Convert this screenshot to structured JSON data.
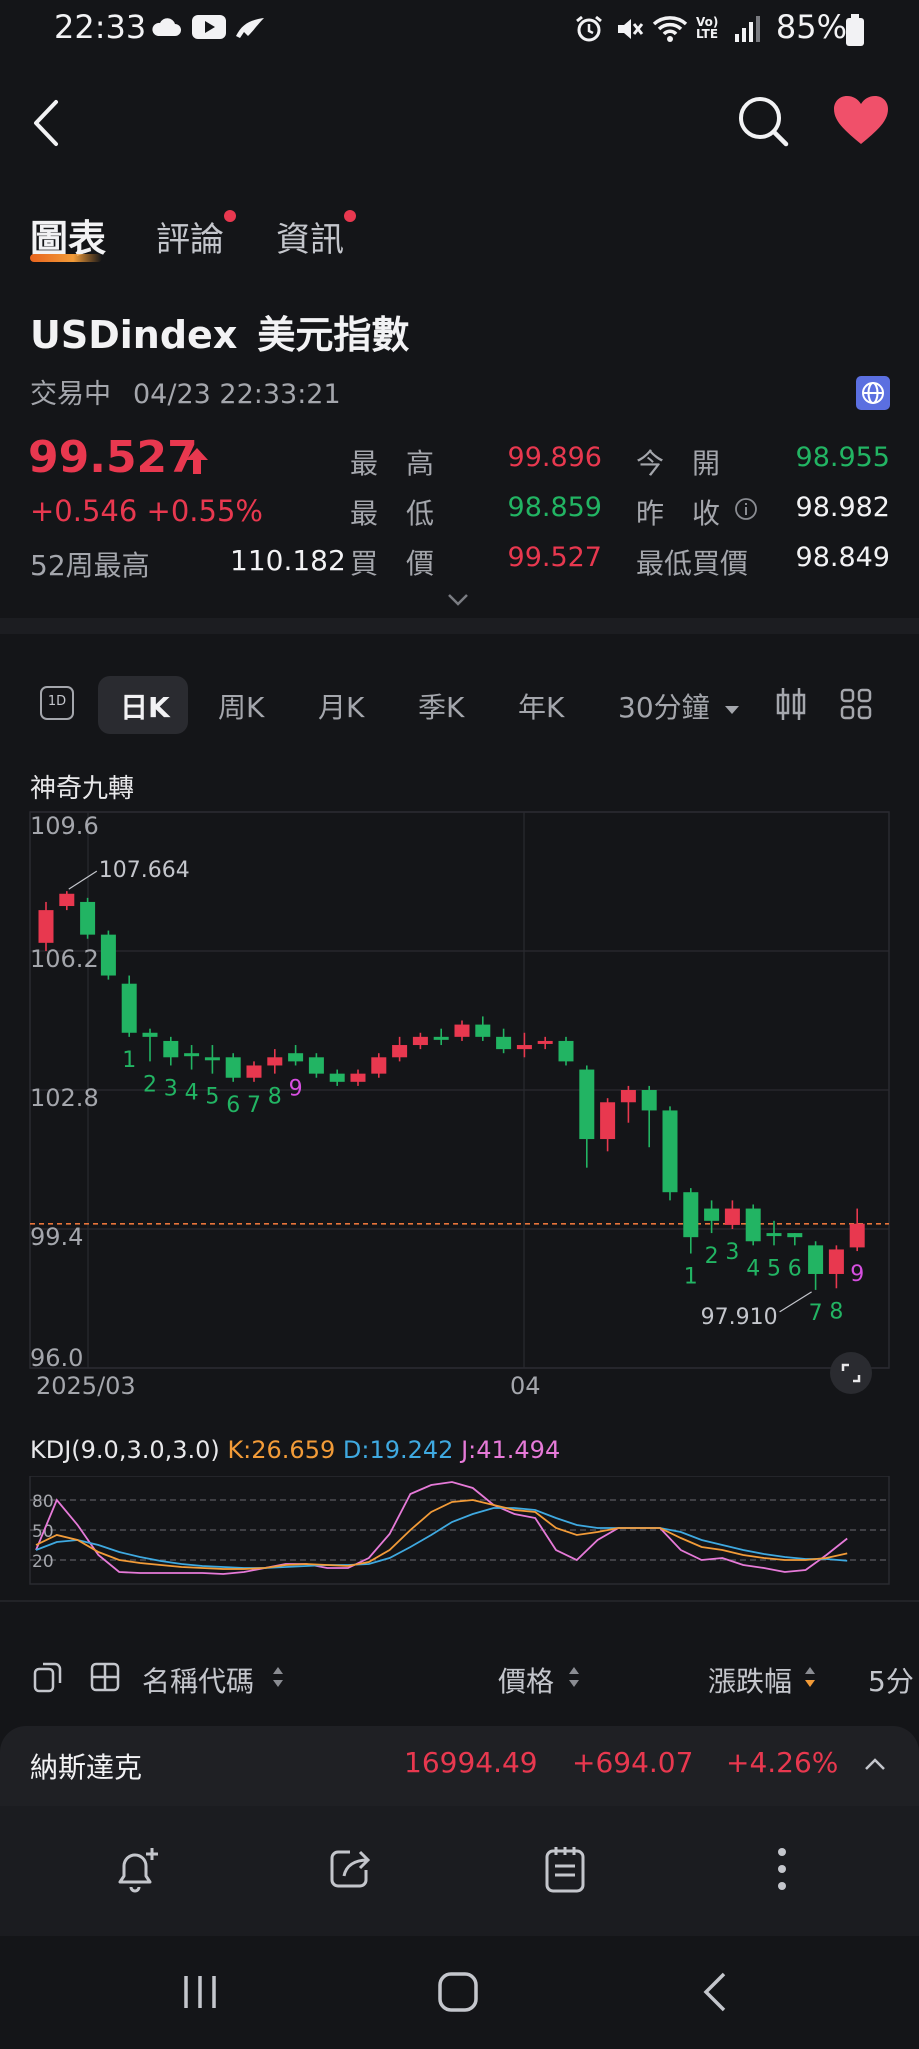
{
  "status_bar": {
    "time": "22:33",
    "battery": "85%"
  },
  "tabs": [
    {
      "label": "圖表"
    },
    {
      "label": "評論"
    },
    {
      "label": "資訊"
    }
  ],
  "instrument": {
    "symbol": "USDindex",
    "name": "美元指數",
    "status": "交易中",
    "datetime": "04/23 22:33:21",
    "price": "99.527",
    "change": "+0.546",
    "change_pct": "+0.55%",
    "w52_high_label": "52周最高",
    "w52_high": "110.182"
  },
  "quote_fields": {
    "high_label": "最　高",
    "high": "99.896",
    "low_label": "最　低",
    "low": "98.859",
    "bid_label": "買　價",
    "bid": "99.527",
    "open_label": "今　開",
    "open": "98.955",
    "prev_close_label": "昨　收",
    "prev_close": "98.982",
    "min_bid_label": "最低買價",
    "min_bid": "98.849"
  },
  "periods": {
    "icon_1d": "1D",
    "items": [
      "日K",
      "周K",
      "月K",
      "季K",
      "年K",
      "30分鐘"
    ],
    "selected": "日K"
  },
  "chart": {
    "indicator_title": "神奇九轉",
    "x_labels": [
      "2025/03",
      "04"
    ],
    "high_annotation": "107.664",
    "low_annotation": "97.910",
    "kdj_label": "KDJ(9.0,3.0,3.0)",
    "k_label": "K:26.659",
    "d_label": "D:19.242",
    "j_label": "J:41.494",
    "kdj_levels": [
      "80",
      "50",
      "20"
    ]
  },
  "chart_data": {
    "type": "candlestick",
    "y_ticks": [
      "109.6",
      "106.2",
      "102.8",
      "99.4",
      "96.0"
    ],
    "ylim": [
      96.0,
      109.6
    ],
    "current_price_line": 99.527,
    "candles": [
      {
        "o": 106.4,
        "c": 107.2,
        "h": 107.4,
        "l": 106.2,
        "up": true
      },
      {
        "o": 107.3,
        "c": 107.6,
        "h": 107.664,
        "l": 107.2,
        "up": true
      },
      {
        "o": 107.4,
        "c": 106.6,
        "h": 107.5,
        "l": 106.5,
        "up": false
      },
      {
        "o": 106.6,
        "c": 105.6,
        "h": 106.7,
        "l": 105.5,
        "up": false
      },
      {
        "o": 105.4,
        "c": 104.2,
        "h": 105.6,
        "l": 104.1,
        "up": false
      },
      {
        "o": 104.2,
        "c": 104.1,
        "h": 104.3,
        "l": 103.5,
        "up": false
      },
      {
        "o": 104.0,
        "c": 103.6,
        "h": 104.1,
        "l": 103.4,
        "up": false
      },
      {
        "o": 103.7,
        "c": 103.7,
        "h": 103.9,
        "l": 103.3,
        "up": false
      },
      {
        "o": 103.6,
        "c": 103.6,
        "h": 103.9,
        "l": 103.2,
        "up": false
      },
      {
        "o": 103.6,
        "c": 103.1,
        "h": 103.7,
        "l": 103.0,
        "up": false
      },
      {
        "o": 103.1,
        "c": 103.4,
        "h": 103.5,
        "l": 103.0,
        "up": true
      },
      {
        "o": 103.4,
        "c": 103.6,
        "h": 103.8,
        "l": 103.2,
        "up": true
      },
      {
        "o": 103.7,
        "c": 103.5,
        "h": 103.9,
        "l": 103.4,
        "up": false
      },
      {
        "o": 103.6,
        "c": 103.2,
        "h": 103.7,
        "l": 103.1,
        "up": false
      },
      {
        "o": 103.2,
        "c": 103.0,
        "h": 103.3,
        "l": 102.9,
        "up": false
      },
      {
        "o": 103.0,
        "c": 103.2,
        "h": 103.3,
        "l": 102.9,
        "up": true
      },
      {
        "o": 103.2,
        "c": 103.6,
        "h": 103.7,
        "l": 103.1,
        "up": true
      },
      {
        "o": 103.6,
        "c": 103.9,
        "h": 104.1,
        "l": 103.5,
        "up": true
      },
      {
        "o": 103.9,
        "c": 104.1,
        "h": 104.2,
        "l": 103.8,
        "up": true
      },
      {
        "o": 104.1,
        "c": 104.1,
        "h": 104.3,
        "l": 103.9,
        "up": false
      },
      {
        "o": 104.1,
        "c": 104.4,
        "h": 104.5,
        "l": 104.0,
        "up": true
      },
      {
        "o": 104.4,
        "c": 104.1,
        "h": 104.6,
        "l": 104.0,
        "up": false
      },
      {
        "o": 104.1,
        "c": 103.8,
        "h": 104.3,
        "l": 103.7,
        "up": false
      },
      {
        "o": 103.8,
        "c": 103.9,
        "h": 104.2,
        "l": 103.6,
        "up": true
      },
      {
        "o": 104.0,
        "c": 104.0,
        "h": 104.1,
        "l": 103.8,
        "up": true
      },
      {
        "o": 104.0,
        "c": 103.5,
        "h": 104.1,
        "l": 103.4,
        "up": false
      },
      {
        "o": 103.3,
        "c": 101.6,
        "h": 103.4,
        "l": 100.9,
        "up": false
      },
      {
        "o": 101.6,
        "c": 102.5,
        "h": 102.6,
        "l": 101.3,
        "up": true
      },
      {
        "o": 102.5,
        "c": 102.8,
        "h": 102.9,
        "l": 102.0,
        "up": true
      },
      {
        "o": 102.8,
        "c": 102.3,
        "h": 102.9,
        "l": 101.4,
        "up": false
      },
      {
        "o": 102.3,
        "c": 100.3,
        "h": 102.4,
        "l": 100.1,
        "up": false
      },
      {
        "o": 100.3,
        "c": 99.2,
        "h": 100.4,
        "l": 98.8,
        "up": false
      },
      {
        "o": 99.9,
        "c": 99.6,
        "h": 100.1,
        "l": 99.3,
        "up": false
      },
      {
        "o": 99.5,
        "c": 99.9,
        "h": 100.1,
        "l": 99.4,
        "up": true
      },
      {
        "o": 99.9,
        "c": 99.1,
        "h": 100.0,
        "l": 99.0,
        "up": false
      },
      {
        "o": 99.3,
        "c": 99.3,
        "h": 99.6,
        "l": 99.0,
        "up": false
      },
      {
        "o": 99.3,
        "c": 99.2,
        "h": 99.3,
        "l": 99.0,
        "up": false
      },
      {
        "o": 99.0,
        "c": 98.3,
        "h": 99.1,
        "l": 97.91,
        "up": false
      },
      {
        "o": 98.3,
        "c": 98.9,
        "h": 99.0,
        "l": 97.95,
        "up": true
      },
      {
        "o": 98.95,
        "c": 99.53,
        "h": 99.9,
        "l": 98.86,
        "up": true
      }
    ],
    "td_counts": [
      {
        "i": 4,
        "n": "1",
        "pos": "below",
        "color": "green"
      },
      {
        "i": 5,
        "n": "2",
        "pos": "below",
        "color": "green"
      },
      {
        "i": 6,
        "n": "3",
        "pos": "below",
        "color": "green"
      },
      {
        "i": 7,
        "n": "4",
        "pos": "below",
        "color": "green"
      },
      {
        "i": 8,
        "n": "5",
        "pos": "below",
        "color": "green"
      },
      {
        "i": 9,
        "n": "6",
        "pos": "below",
        "color": "green"
      },
      {
        "i": 10,
        "n": "7",
        "pos": "below",
        "color": "green"
      },
      {
        "i": 11,
        "n": "8",
        "pos": "below",
        "color": "green"
      },
      {
        "i": 12,
        "n": "9",
        "pos": "below",
        "color": "magenta"
      },
      {
        "i": 31,
        "n": "1",
        "pos": "below",
        "color": "green"
      },
      {
        "i": 32,
        "n": "2",
        "pos": "below",
        "color": "green"
      },
      {
        "i": 33,
        "n": "3",
        "pos": "below",
        "color": "green"
      },
      {
        "i": 34,
        "n": "4",
        "pos": "below",
        "color": "green"
      },
      {
        "i": 35,
        "n": "5",
        "pos": "below",
        "color": "green"
      },
      {
        "i": 36,
        "n": "6",
        "pos": "below",
        "color": "green"
      },
      {
        "i": 37,
        "n": "7",
        "pos": "below",
        "color": "green"
      },
      {
        "i": 38,
        "n": "8",
        "pos": "below",
        "color": "green"
      },
      {
        "i": 39,
        "n": "9",
        "pos": "below",
        "color": "magenta"
      }
    ],
    "kdj": {
      "ylim": [
        0,
        100
      ],
      "K": [
        35,
        45,
        40,
        28,
        20,
        17,
        15,
        13,
        12,
        11,
        11,
        12,
        15,
        16,
        15,
        14,
        18,
        30,
        50,
        68,
        78,
        80,
        75,
        70,
        68,
        52,
        45,
        48,
        52,
        52,
        52,
        42,
        33,
        30,
        25,
        22,
        20,
        20,
        22,
        26.659
      ],
      "D": [
        30,
        38,
        40,
        35,
        28,
        23,
        19,
        16,
        14,
        13,
        12,
        12,
        13,
        14,
        15,
        15,
        16,
        22,
        33,
        45,
        58,
        66,
        72,
        72,
        70,
        62,
        55,
        52,
        52,
        52,
        52,
        48,
        40,
        35,
        30,
        26,
        23,
        21,
        21,
        19.242
      ],
      "J": [
        30,
        80,
        55,
        25,
        8,
        7,
        7,
        7,
        7,
        6,
        8,
        12,
        16,
        16,
        12,
        12,
        22,
        46,
        86,
        95,
        98,
        92,
        75,
        66,
        62,
        30,
        20,
        40,
        52,
        52,
        52,
        30,
        20,
        22,
        15,
        12,
        8,
        10,
        25,
        41.494
      ]
    },
    "colors": {
      "up": "#e8384f",
      "down": "#22b463",
      "K": "#f29b38",
      "D": "#3fa9e0",
      "J": "#e67ad8"
    }
  },
  "watchlist": {
    "headers": {
      "name": "名稱代碼",
      "price": "價格",
      "change_pct": "漲跌幅",
      "more": "5分"
    },
    "row": {
      "name": "納斯達克",
      "price": "16994.49",
      "change": "+694.07",
      "change_pct": "+4.26%"
    }
  }
}
